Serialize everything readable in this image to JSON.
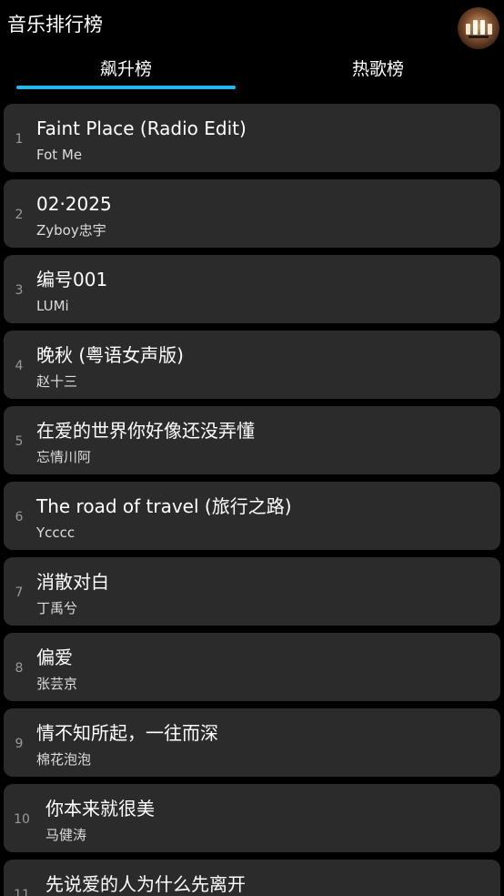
{
  "app": {
    "title": "音乐排行榜",
    "avatar_icon": "user-avatar-icon"
  },
  "tabs": [
    {
      "label": "飙升榜",
      "selected": true
    },
    {
      "label": "热歌榜",
      "selected": false
    }
  ],
  "colors": {
    "background": "#000000",
    "card": "#2b2b2b",
    "accent": "#29b6e8",
    "rank_text": "#9a9a9a"
  },
  "songs": [
    {
      "rank": "1",
      "title": "Faint Place (Radio Edit)",
      "artist": "Fot Me"
    },
    {
      "rank": "2",
      "title": "02·2025",
      "artist": "Zyboy忠宇"
    },
    {
      "rank": "3",
      "title": "编号001",
      "artist": "LUMi"
    },
    {
      "rank": "4",
      "title": "晚秋 (粤语女声版)",
      "artist": "赵十三"
    },
    {
      "rank": "5",
      "title": "在爱的世界你好像还没弄懂",
      "artist": "忘情川阿"
    },
    {
      "rank": "6",
      "title": "The road of travel (旅行之路)",
      "artist": "Ycccc"
    },
    {
      "rank": "7",
      "title": "消散对白",
      "artist": "丁禹兮"
    },
    {
      "rank": "8",
      "title": "偏爱",
      "artist": "张芸京"
    },
    {
      "rank": "9",
      "title": "情不知所起，一往而深",
      "artist": "棉花泡泡"
    },
    {
      "rank": "10",
      "title": "你本来就很美",
      "artist": "马健涛"
    },
    {
      "rank": "11",
      "title": "先说爱的人为什么先离开",
      "artist": ""
    }
  ]
}
